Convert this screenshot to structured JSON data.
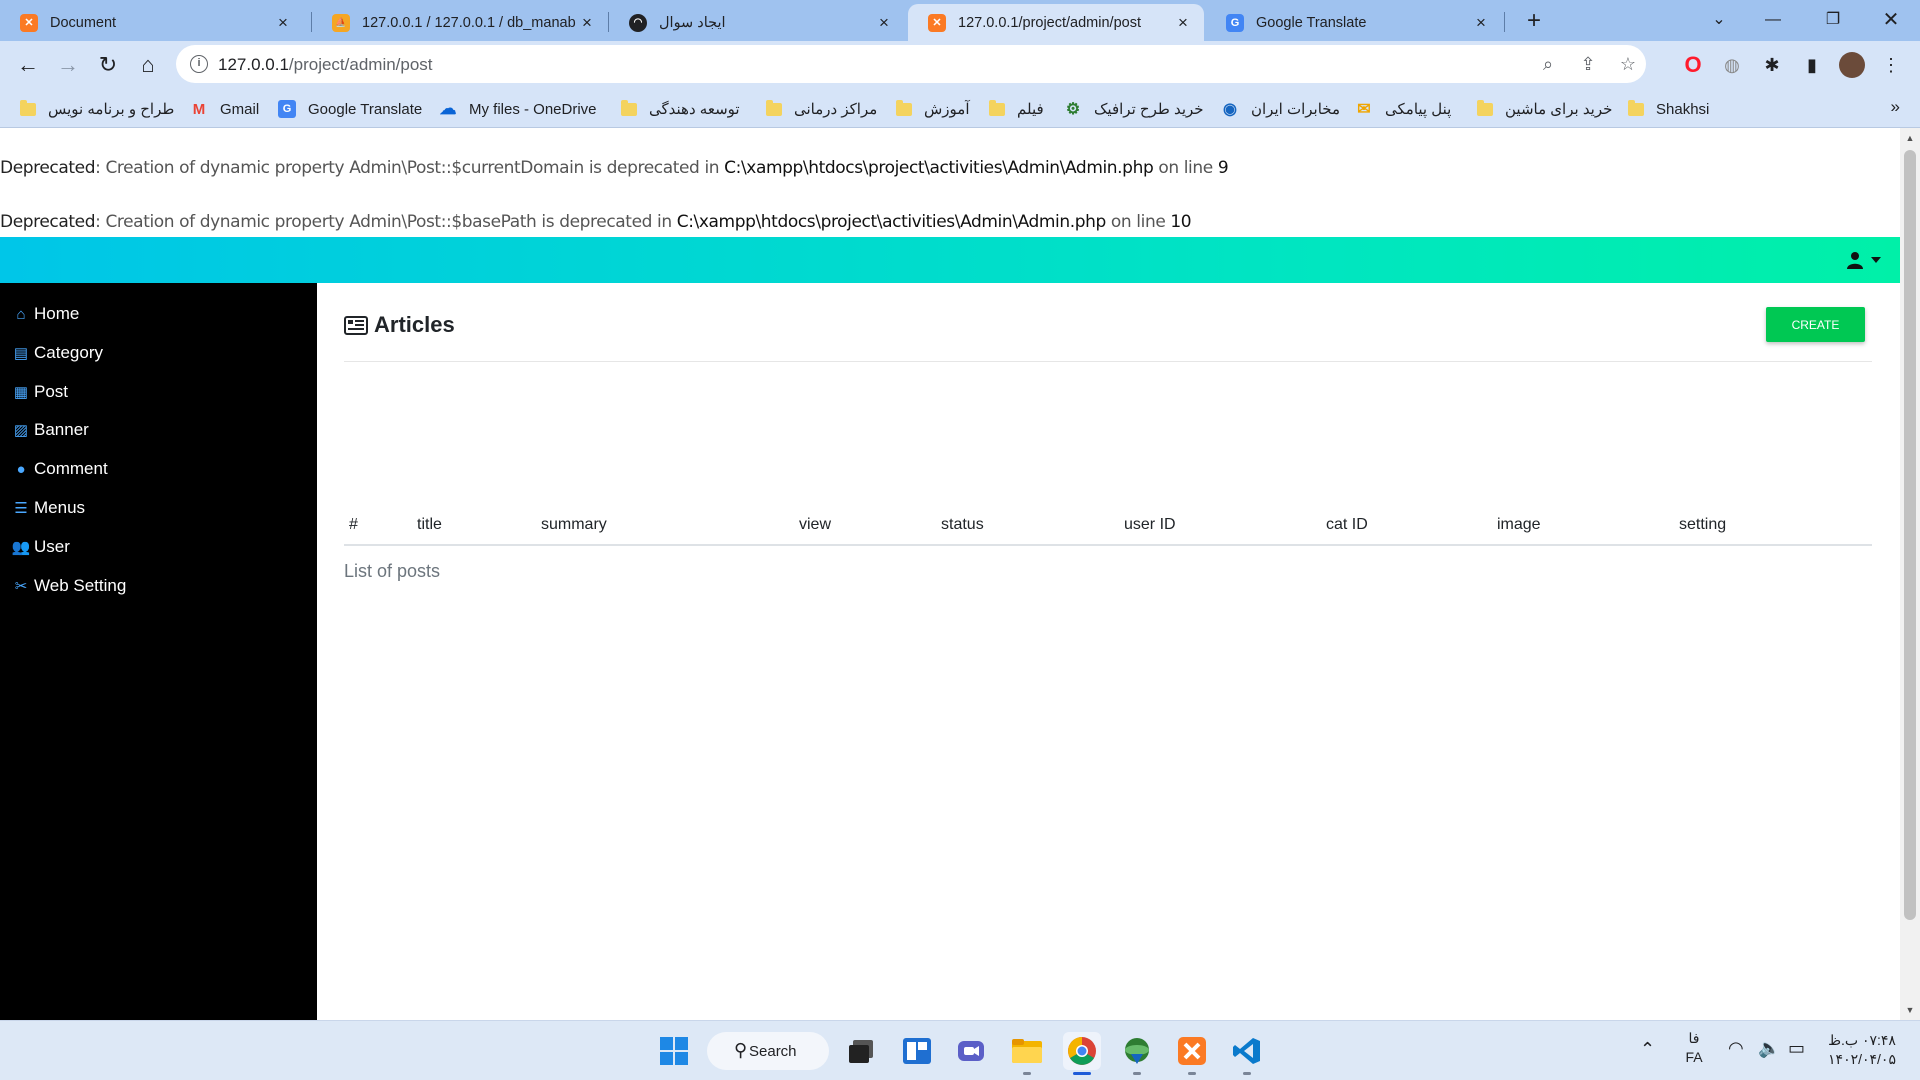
{
  "browser": {
    "tabs": [
      {
        "title": "Document",
        "favicon": "xampp-icon",
        "active": false
      },
      {
        "title": "127.0.0.1 / 127.0.0.1 / db_manab",
        "favicon": "phpmyadmin-icon",
        "active": false
      },
      {
        "title": "ایجاد سوال",
        "favicon": "ghost-icon",
        "active": false
      },
      {
        "title": "127.0.0.1/project/admin/post",
        "favicon": "xampp-icon",
        "active": true
      },
      {
        "title": "Google Translate",
        "favicon": "google-translate-icon",
        "active": false
      }
    ],
    "url_host": "127.0.0.1",
    "url_path": "/project/admin/post",
    "bookmarks": [
      {
        "label": "طراح و برنامه نویس",
        "icon": "folder-icon"
      },
      {
        "label": "Gmail",
        "icon": "gmail-icon"
      },
      {
        "label": "Google Translate",
        "icon": "google-translate-icon"
      },
      {
        "label": "My files - OneDrive",
        "icon": "onedrive-icon"
      },
      {
        "label": "توسعه دهندگی",
        "icon": "folder-icon"
      },
      {
        "label": "مراکز درمانی",
        "icon": "folder-icon"
      },
      {
        "label": "آموزش",
        "icon": "folder-icon"
      },
      {
        "label": "فیلم",
        "icon": "folder-icon"
      },
      {
        "label": "خرید طرح ترافیک",
        "icon": "gear-icon"
      },
      {
        "label": "مخابرات ایران",
        "icon": "globe-icon"
      },
      {
        "label": "پنل پیامکی",
        "icon": "mail-icon"
      },
      {
        "label": "خرید برای ماشین",
        "icon": "folder-icon"
      },
      {
        "label": "Shakhsi",
        "icon": "folder-icon"
      }
    ],
    "bookmarks_more": "»"
  },
  "warnings": [
    {
      "label": "Deprecated",
      "message": ": Creation of dynamic property Admin\\Post::$currentDomain is deprecated in ",
      "file": "C:\\xampp\\htdocs\\project\\activities\\Admin\\Admin.php",
      "on_line": " on line ",
      "line": "9"
    },
    {
      "label": "Deprecated",
      "message": ": Creation of dynamic property Admin\\Post::$basePath is deprecated in ",
      "file": "C:\\xampp\\htdocs\\project\\activities\\Admin\\Admin.php",
      "on_line": " on line ",
      "line": "10"
    }
  ],
  "sidebar": {
    "items": [
      {
        "label": "Home",
        "icon": "home-icon"
      },
      {
        "label": "Category",
        "icon": "clipboard-icon"
      },
      {
        "label": "Post",
        "icon": "newspaper-icon"
      },
      {
        "label": "Banner",
        "icon": "image-icon"
      },
      {
        "label": "Comment",
        "icon": "comments-icon"
      },
      {
        "label": "Menus",
        "icon": "bars-icon"
      },
      {
        "label": "User",
        "icon": "users-icon"
      },
      {
        "label": "Web Setting",
        "icon": "tools-icon"
      }
    ]
  },
  "main": {
    "title": "Articles",
    "create_label": "CREATE",
    "columns": [
      "#",
      "title",
      "summary",
      "view",
      "status",
      "user ID",
      "cat ID",
      "image",
      "setting"
    ],
    "caption": "List of posts"
  },
  "taskbar": {
    "search_label": "Search",
    "lang_top": "فا",
    "lang_bottom": "FA",
    "time": "۰۷:۴۸ ب.ظ",
    "date": "۱۴۰۲/۰۴/۰۵"
  },
  "colors": {
    "topnav_start": "#00c6e8",
    "topnav_end": "#00f0a8",
    "sidebar_bg": "#000000",
    "sidebar_icon": "#4aa8ff",
    "create_button": "#00c853"
  }
}
